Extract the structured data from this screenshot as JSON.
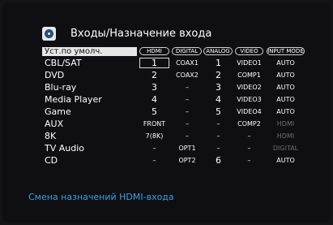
{
  "header": {
    "icon": "input-assign-icon",
    "title": "Входы/Назначение входа"
  },
  "default_button": "Уст.по умолч.",
  "columns": [
    "HDMI",
    "DIGITAL",
    "ANALOG",
    "VIDEO",
    "INPUT MODE"
  ],
  "rows": [
    {
      "source": "CBL/SAT",
      "hdmi": "1",
      "digital": "COAX1",
      "analog": "1",
      "video": "VIDEO1",
      "mode": "AUTO",
      "mode_dim": false,
      "selected": true
    },
    {
      "source": "DVD",
      "hdmi": "2",
      "digital": "COAX2",
      "analog": "2",
      "video": "COMP1",
      "mode": "AUTO",
      "mode_dim": false
    },
    {
      "source": "Blu-ray",
      "hdmi": "3",
      "digital": "–",
      "analog": "3",
      "video": "VIDEO2",
      "mode": "AUTO",
      "mode_dim": false
    },
    {
      "source": "Media Player",
      "hdmi": "4",
      "digital": "–",
      "analog": "4",
      "video": "VIDEO3",
      "mode": "AUTO",
      "mode_dim": false
    },
    {
      "source": "Game",
      "hdmi": "5",
      "digital": "–",
      "analog": "5",
      "video": "VIDEO4",
      "mode": "AUTO",
      "mode_dim": false
    },
    {
      "source": "AUX",
      "hdmi": "FRONT",
      "digital": "–",
      "analog": "–",
      "video": "COMP2",
      "mode": "HDMI",
      "mode_dim": true
    },
    {
      "source": "8K",
      "hdmi": "7(8K)",
      "digital": "–",
      "analog": "–",
      "video": "–",
      "mode": "HDMI",
      "mode_dim": true
    },
    {
      "source": "TV Audio",
      "hdmi": "–",
      "digital": "OPT1",
      "analog": "–",
      "video": "–",
      "mode": "DIGITAL",
      "mode_dim": true
    },
    {
      "source": "CD",
      "hdmi": "–",
      "digital": "OPT2",
      "analog": "6",
      "video": "–",
      "mode": "AUTO",
      "mode_dim": false
    }
  ],
  "footer": "Смена назначений HDMI-входа",
  "colors": {
    "footer_text": "#3aa0e0",
    "dim_text": "#6a6a70",
    "background": "#0f0f13"
  }
}
